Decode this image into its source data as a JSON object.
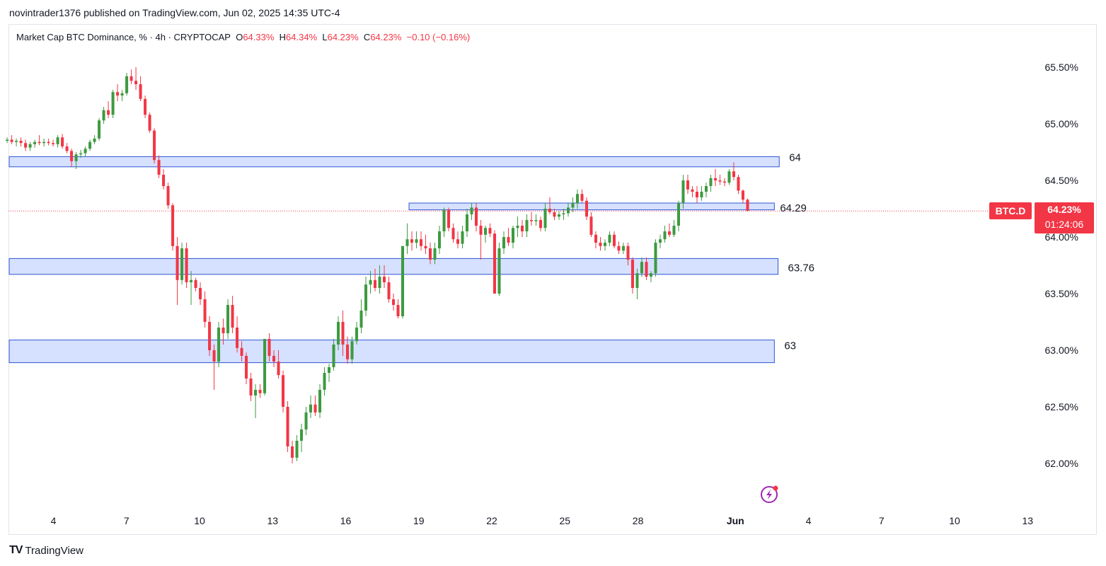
{
  "header": {
    "published_by": "novintrader1376 published on TradingView.com, Jun 02, 2025 14:35 UTC-4"
  },
  "legend": {
    "title": "Market Cap BTC Dominance, % · 4h · CRYPTOCAP",
    "o_label": "O",
    "o_value": "64.33%",
    "h_label": "H",
    "h_value": "64.34%",
    "l_label": "L",
    "l_value": "64.23%",
    "c_label": "C",
    "c_value": "64.23%",
    "change": "−0.10 (−0.16%)"
  },
  "price_tag": {
    "symbol": "BTC.D",
    "price": "64.23%",
    "countdown": "01:24:06"
  },
  "footer": {
    "brand_mark": "TV",
    "brand": "TradingView"
  },
  "colors": {
    "up": "#3d9a40",
    "down": "#f23645",
    "zone_fill": "#cfdcff",
    "zone_border": "#2f55d4",
    "accent": "#9c27b0"
  },
  "icons": [
    "lightning-alert-icon",
    "tradingview-logo-icon"
  ],
  "chart_data": {
    "type": "candlestick",
    "timeframe": "4h",
    "y_unit": "%",
    "ylim": [
      61.6,
      65.75
    ],
    "y_ticks": [
      "65.50%",
      "65.00%",
      "64.50%",
      "64.00%",
      "63.50%",
      "63.00%",
      "62.50%",
      "62.00%"
    ],
    "y_tick_values": [
      65.5,
      65.0,
      64.5,
      64.0,
      63.5,
      63.0,
      62.5,
      62.0
    ],
    "x_ticks": [
      "4",
      "7",
      "10",
      "13",
      "16",
      "19",
      "22",
      "25",
      "28",
      "Jun",
      "4",
      "7",
      "10",
      "13"
    ],
    "x_tick_days": [
      4,
      7,
      10,
      13,
      16,
      19,
      22,
      25,
      28,
      32,
      35,
      38,
      41,
      44
    ],
    "x_start_day": 2,
    "current_price": 64.23,
    "zones": [
      {
        "label": "64",
        "low": 64.62,
        "high": 64.71,
        "from_day": 2,
        "to_day": 33.8
      },
      {
        "label": "64.29",
        "low": 64.24,
        "high": 64.3,
        "from_day": 18.6,
        "to_day": 33.6
      },
      {
        "label": "63.76",
        "low": 63.67,
        "high": 63.81,
        "from_day": 2,
        "to_day": 33.75
      },
      {
        "label": "63",
        "low": 62.89,
        "high": 63.09,
        "from_day": 2,
        "to_day": 33.6
      }
    ],
    "candles": [
      [
        64.85,
        64.88,
        64.83,
        64.86
      ],
      [
        64.86,
        64.9,
        64.82,
        64.84
      ],
      [
        64.84,
        64.87,
        64.8,
        64.85
      ],
      [
        64.85,
        64.88,
        64.8,
        64.83
      ],
      [
        64.83,
        64.86,
        64.76,
        64.79
      ],
      [
        64.79,
        64.84,
        64.76,
        64.82
      ],
      [
        64.82,
        64.86,
        64.79,
        64.84
      ],
      [
        64.84,
        64.9,
        64.81,
        64.83
      ],
      [
        64.83,
        64.87,
        64.8,
        64.84
      ],
      [
        64.84,
        64.87,
        64.81,
        64.83
      ],
      [
        64.83,
        64.86,
        64.8,
        64.82
      ],
      [
        64.82,
        64.9,
        64.79,
        64.88
      ],
      [
        64.88,
        64.91,
        64.78,
        64.8
      ],
      [
        64.8,
        64.83,
        64.74,
        64.76
      ],
      [
        64.76,
        64.78,
        64.62,
        64.67
      ],
      [
        64.67,
        64.75,
        64.6,
        64.73
      ],
      [
        64.73,
        64.77,
        64.7,
        64.74
      ],
      [
        64.74,
        64.8,
        64.71,
        64.78
      ],
      [
        64.78,
        64.86,
        64.76,
        64.84
      ],
      [
        64.84,
        64.9,
        64.82,
        64.87
      ],
      [
        64.87,
        65.05,
        64.85,
        65.03
      ],
      [
        65.03,
        65.15,
        65.0,
        65.12
      ],
      [
        65.12,
        65.2,
        65.05,
        65.08
      ],
      [
        65.08,
        65.3,
        65.05,
        65.28
      ],
      [
        65.28,
        65.35,
        65.2,
        65.25
      ],
      [
        65.25,
        65.3,
        65.2,
        65.27
      ],
      [
        65.27,
        65.45,
        65.25,
        65.42
      ],
      [
        65.42,
        65.48,
        65.35,
        65.38
      ],
      [
        65.38,
        65.5,
        65.3,
        65.35
      ],
      [
        65.35,
        65.42,
        65.2,
        65.22
      ],
      [
        65.22,
        65.25,
        65.05,
        65.08
      ],
      [
        65.08,
        65.1,
        64.92,
        64.94
      ],
      [
        64.94,
        64.96,
        64.65,
        64.68
      ],
      [
        64.68,
        64.72,
        64.52,
        64.55
      ],
      [
        64.55,
        64.6,
        64.42,
        64.45
      ],
      [
        64.45,
        64.48,
        64.25,
        64.28
      ],
      [
        64.28,
        64.3,
        63.88,
        63.92
      ],
      [
        63.92,
        64.0,
        63.4,
        63.62
      ],
      [
        63.62,
        63.95,
        63.58,
        63.9
      ],
      [
        63.9,
        63.95,
        63.55,
        63.6
      ],
      [
        63.6,
        63.7,
        63.4,
        63.62
      ],
      [
        63.62,
        63.64,
        63.52,
        63.55
      ],
      [
        63.55,
        63.6,
        63.4,
        63.45
      ],
      [
        63.45,
        63.52,
        63.2,
        63.25
      ],
      [
        63.25,
        63.3,
        62.95,
        63.0
      ],
      [
        63.0,
        63.05,
        62.65,
        62.9
      ],
      [
        62.9,
        63.25,
        62.85,
        63.2
      ],
      [
        63.2,
        63.28,
        63.05,
        63.15
      ],
      [
        63.15,
        63.45,
        63.1,
        63.4
      ],
      [
        63.4,
        63.48,
        63.15,
        63.2
      ],
      [
        63.2,
        63.3,
        62.98,
        63.02
      ],
      [
        63.02,
        63.08,
        62.9,
        62.95
      ],
      [
        62.95,
        62.98,
        62.7,
        62.75
      ],
      [
        62.75,
        62.8,
        62.55,
        62.6
      ],
      [
        62.6,
        62.7,
        62.4,
        62.65
      ],
      [
        62.65,
        62.7,
        62.58,
        62.62
      ],
      [
        62.62,
        63.1,
        62.6,
        63.1
      ],
      [
        63.1,
        63.15,
        62.9,
        62.95
      ],
      [
        62.95,
        63.0,
        62.85,
        62.9
      ],
      [
        62.9,
        63.0,
        62.75,
        62.78
      ],
      [
        62.78,
        62.82,
        62.45,
        62.5
      ],
      [
        62.5,
        62.55,
        62.1,
        62.15
      ],
      [
        62.15,
        62.2,
        62.0,
        62.05
      ],
      [
        62.05,
        62.25,
        62.02,
        62.2
      ],
      [
        62.2,
        62.35,
        62.1,
        62.3
      ],
      [
        62.3,
        62.5,
        62.25,
        62.45
      ],
      [
        62.45,
        62.6,
        62.4,
        62.52
      ],
      [
        62.52,
        62.6,
        62.42,
        62.45
      ],
      [
        62.45,
        62.7,
        62.4,
        62.65
      ],
      [
        62.65,
        62.85,
        62.6,
        62.8
      ],
      [
        62.8,
        62.88,
        62.72,
        62.85
      ],
      [
        62.85,
        63.1,
        62.82,
        63.05
      ],
      [
        63.05,
        63.3,
        63.0,
        63.25
      ],
      [
        63.25,
        63.35,
        62.95,
        63.05
      ],
      [
        63.05,
        63.12,
        62.88,
        62.92
      ],
      [
        62.92,
        63.12,
        62.88,
        63.08
      ],
      [
        63.08,
        63.25,
        63.05,
        63.2
      ],
      [
        63.2,
        63.45,
        63.15,
        63.35
      ],
      [
        63.35,
        63.65,
        63.3,
        63.58
      ],
      [
        63.58,
        63.7,
        63.5,
        63.62
      ],
      [
        63.62,
        63.72,
        63.52,
        63.55
      ],
      [
        63.55,
        63.75,
        63.5,
        63.65
      ],
      [
        63.65,
        63.75,
        63.55,
        63.6
      ],
      [
        63.6,
        63.65,
        63.42,
        63.45
      ],
      [
        63.45,
        63.5,
        63.35,
        63.4
      ],
      [
        63.4,
        63.45,
        63.28,
        63.3
      ],
      [
        63.3,
        63.92,
        63.28,
        63.92
      ],
      [
        63.92,
        64.12,
        63.85,
        63.98
      ],
      [
        63.98,
        64.05,
        63.88,
        63.95
      ],
      [
        63.95,
        64.05,
        63.9,
        63.98
      ],
      [
        63.98,
        64.05,
        63.88,
        63.92
      ],
      [
        63.92,
        64.02,
        63.85,
        63.9
      ],
      [
        63.9,
        63.95,
        63.76,
        63.8
      ],
      [
        63.8,
        63.95,
        63.76,
        63.9
      ],
      [
        63.9,
        64.1,
        63.85,
        64.05
      ],
      [
        64.05,
        64.26,
        64.0,
        64.24
      ],
      [
        64.24,
        64.26,
        64.05,
        64.08
      ],
      [
        64.08,
        64.12,
        63.95,
        63.98
      ],
      [
        63.98,
        64.05,
        63.9,
        63.94
      ],
      [
        63.94,
        64.1,
        63.9,
        64.05
      ],
      [
        64.05,
        64.25,
        64.0,
        64.2
      ],
      [
        64.2,
        64.3,
        64.15,
        64.26
      ],
      [
        64.26,
        64.3,
        64.05,
        64.1
      ],
      [
        64.1,
        64.15,
        63.8,
        64.02
      ],
      [
        64.02,
        64.1,
        63.95,
        64.08
      ],
      [
        64.08,
        64.12,
        64.0,
        64.03
      ],
      [
        64.03,
        64.06,
        63.5,
        63.5
      ],
      [
        63.5,
        63.95,
        63.48,
        63.9
      ],
      [
        63.9,
        64.05,
        63.85,
        64.0
      ],
      [
        64.0,
        64.08,
        63.92,
        63.95
      ],
      [
        63.95,
        64.1,
        63.9,
        64.08
      ],
      [
        64.08,
        64.18,
        64.0,
        64.1
      ],
      [
        64.1,
        64.15,
        64.0,
        64.05
      ],
      [
        64.05,
        64.2,
        64.0,
        64.15
      ],
      [
        64.15,
        64.22,
        64.1,
        64.14
      ],
      [
        64.14,
        64.2,
        64.1,
        64.15
      ],
      [
        64.15,
        64.18,
        64.05,
        64.08
      ],
      [
        64.08,
        64.3,
        64.05,
        64.25
      ],
      [
        64.25,
        64.35,
        64.2,
        64.22
      ],
      [
        64.22,
        64.25,
        64.15,
        64.18
      ],
      [
        64.18,
        64.23,
        64.15,
        64.2
      ],
      [
        64.2,
        64.25,
        64.15,
        64.21
      ],
      [
        64.21,
        64.3,
        64.18,
        64.26
      ],
      [
        64.26,
        64.35,
        64.22,
        64.3
      ],
      [
        64.3,
        64.42,
        64.25,
        64.38
      ],
      [
        64.38,
        64.42,
        64.3,
        64.32
      ],
      [
        64.32,
        64.35,
        64.15,
        64.18
      ],
      [
        64.18,
        64.22,
        64.0,
        64.02
      ],
      [
        64.02,
        64.05,
        63.9,
        63.95
      ],
      [
        63.95,
        64.0,
        63.88,
        63.92
      ],
      [
        63.92,
        63.98,
        63.88,
        63.95
      ],
      [
        63.95,
        64.05,
        63.92,
        64.02
      ],
      [
        64.02,
        64.05,
        63.9,
        63.92
      ],
      [
        63.92,
        63.96,
        63.85,
        63.88
      ],
      [
        63.88,
        63.95,
        63.85,
        63.92
      ],
      [
        63.92,
        63.95,
        63.75,
        63.8
      ],
      [
        63.8,
        63.82,
        63.5,
        63.55
      ],
      [
        63.55,
        63.72,
        63.45,
        63.68
      ],
      [
        63.68,
        63.82,
        63.65,
        63.78
      ],
      [
        63.78,
        63.82,
        63.62,
        63.65
      ],
      [
        63.65,
        63.7,
        63.6,
        63.68
      ],
      [
        63.68,
        63.98,
        63.65,
        63.95
      ],
      [
        63.95,
        64.02,
        63.9,
        63.98
      ],
      [
        63.98,
        64.1,
        63.95,
        64.05
      ],
      [
        64.05,
        64.12,
        64.0,
        64.02
      ],
      [
        64.02,
        64.15,
        64.0,
        64.1
      ],
      [
        64.1,
        64.32,
        64.05,
        64.3
      ],
      [
        64.3,
        64.55,
        64.25,
        64.5
      ],
      [
        64.5,
        64.55,
        64.38,
        64.42
      ],
      [
        64.42,
        64.45,
        64.35,
        64.4
      ],
      [
        64.4,
        64.45,
        64.3,
        64.35
      ],
      [
        64.35,
        64.45,
        64.32,
        64.4
      ],
      [
        64.4,
        64.48,
        64.35,
        64.45
      ],
      [
        64.45,
        64.55,
        64.4,
        64.52
      ],
      [
        64.52,
        64.6,
        64.45,
        64.5
      ],
      [
        64.5,
        64.55,
        64.46,
        64.49
      ],
      [
        64.49,
        64.52,
        64.45,
        64.48
      ],
      [
        64.48,
        64.6,
        64.46,
        64.58
      ],
      [
        64.58,
        64.66,
        64.5,
        64.53
      ],
      [
        64.53,
        64.55,
        64.38,
        64.41
      ],
      [
        64.41,
        64.42,
        64.3,
        64.33
      ],
      [
        64.33,
        64.34,
        64.23,
        64.23
      ]
    ]
  }
}
